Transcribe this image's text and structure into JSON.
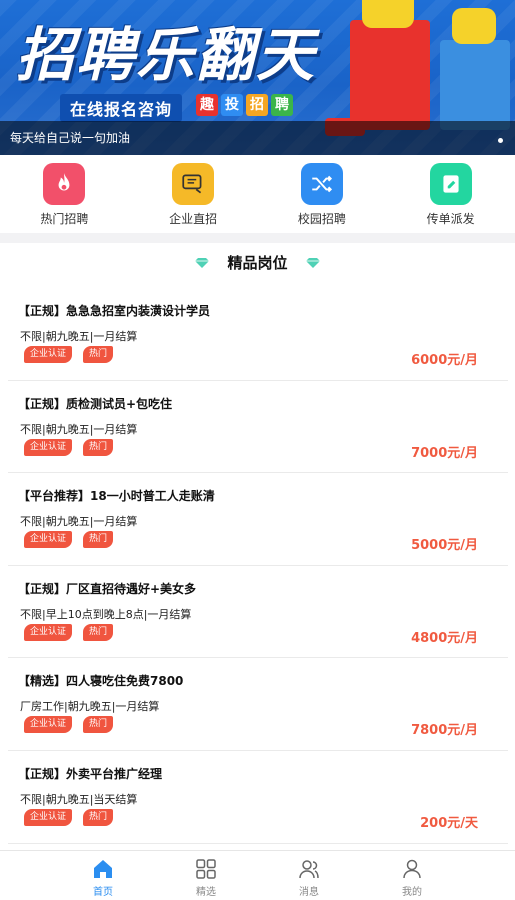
{
  "banner": {
    "title": "招聘乐翻天",
    "subtitle": "在线报名咨询",
    "brand_chars": [
      "趣",
      "投",
      "招",
      "聘"
    ],
    "caption": "每天给自己说一句加油"
  },
  "categories": [
    {
      "label": "热门招聘",
      "icon": "flame-icon",
      "color": "#f2506a"
    },
    {
      "label": "企业直招",
      "icon": "recruit-chat-icon",
      "color": "#f5b928"
    },
    {
      "label": "校园招聘",
      "icon": "shuffle-icon",
      "color": "#2f8df2"
    },
    {
      "label": "传单派发",
      "icon": "flyer-icon",
      "color": "#23d6a0"
    }
  ],
  "section": {
    "title": "精品岗位"
  },
  "jobs": [
    {
      "title": "【正规】急急急招室内装潢设计学员",
      "detail": "不限|朝九晚五|一月结算",
      "tags": [
        "企业认证",
        "热门"
      ],
      "salary": "6000元/月"
    },
    {
      "title": "【正规】质检测试员+包吃住",
      "detail": "不限|朝九晚五|一月结算",
      "tags": [
        "企业认证",
        "热门"
      ],
      "salary": "7000元/月"
    },
    {
      "title": "【平台推荐】18一小时普工人走账清",
      "detail": "不限|朝九晚五|一月结算",
      "tags": [
        "企业认证",
        "热门"
      ],
      "salary": "5000元/月"
    },
    {
      "title": "【正规】厂区直招待遇好+美女多",
      "detail": "不限|早上10点到晚上8点|一月结算",
      "tags": [
        "企业认证",
        "热门"
      ],
      "salary": "4800元/月"
    },
    {
      "title": "【精选】四人寝吃住免费7800",
      "detail": "厂房工作|朝九晚五|一月结算",
      "tags": [
        "企业认证",
        "热门"
      ],
      "salary": "7800元/月"
    },
    {
      "title": "【正规】外卖平台推广经理",
      "detail": "不限|朝九晚五|当天结算",
      "tags": [
        "企业认证",
        "热门"
      ],
      "salary": "200元/天"
    }
  ],
  "tabbar": [
    {
      "label": "首页",
      "icon": "home-icon",
      "active": true
    },
    {
      "label": "精选",
      "icon": "grid-icon",
      "active": false
    },
    {
      "label": "消息",
      "icon": "users-icon",
      "active": false
    },
    {
      "label": "我的",
      "icon": "person-icon",
      "active": false
    }
  ],
  "colors": {
    "accent": "#2b8ef0",
    "salary": "#f05a40",
    "tag": "#f0553f"
  }
}
